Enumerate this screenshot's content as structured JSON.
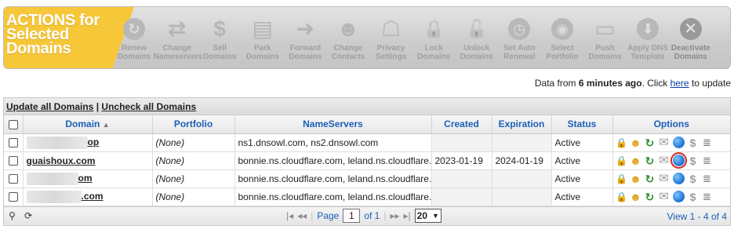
{
  "toolbar": {
    "title": "ACTIONS for Selected Domains",
    "actions": [
      {
        "label": "Renew\nDomains",
        "icon": "renew-icon"
      },
      {
        "label": "Change\nNameservers",
        "icon": "swap-arrows-icon"
      },
      {
        "label": "Sell\nDomains",
        "icon": "dollar-icon"
      },
      {
        "label": "Park\nDomains",
        "icon": "park-icon"
      },
      {
        "label": "Forward\nDomains",
        "icon": "arrow-right-icon"
      },
      {
        "label": "Change\nContacts",
        "icon": "contacts-icon"
      },
      {
        "label": "Privacy\nSettings",
        "icon": "privacy-icon"
      },
      {
        "label": "Lock\nDomains",
        "icon": "lock-icon"
      },
      {
        "label": "Unlock\nDomains",
        "icon": "unlock-icon"
      },
      {
        "label": "Set Auto\nRenewal",
        "icon": "clock-icon"
      },
      {
        "label": "Select\nPortfolio",
        "icon": "portfolio-icon"
      },
      {
        "label": "Push\nDomains",
        "icon": "push-icon"
      },
      {
        "label": "Apply DNS\nTemplate",
        "icon": "dns-template-icon"
      },
      {
        "label": "Deactivate\nDomains",
        "icon": "deactivate-icon"
      }
    ]
  },
  "freshness": {
    "prefix": "Data from ",
    "age": "6 minutes ago",
    "middle": ". Click ",
    "link": "here",
    "suffix": " to update"
  },
  "grid_actions": {
    "update_all": "Update all Domains",
    "separator": "|",
    "uncheck_all": "Uncheck all Domains"
  },
  "columns": {
    "domain": "Domain",
    "portfolio": "Portfolio",
    "nameservers": "NameServers",
    "created": "Created",
    "expiration": "Expiration",
    "status": "Status",
    "options": "Options"
  },
  "rows": [
    {
      "domain": "op",
      "portfolio": "(None)",
      "nameservers": "ns1.dnsowl.com, ns2.dnsowl.com",
      "created": "",
      "expiration": "",
      "status": "Active"
    },
    {
      "domain": "guaishoux.com",
      "portfolio": "(None)",
      "nameservers": "bonnie.ns.cloudflare.com, leland.ns.cloudflare.com",
      "created": "2023-01-19",
      "expiration": "2024-01-19",
      "status": "Active"
    },
    {
      "domain": "om",
      "portfolio": "(None)",
      "nameservers": "bonnie.ns.cloudflare.com, leland.ns.cloudflare.com",
      "created": "",
      "expiration": "",
      "status": "Active"
    },
    {
      "domain": ".com",
      "portfolio": "(None)",
      "nameservers": "bonnie.ns.cloudflare.com, leland.ns.cloudflare.com",
      "created": "",
      "expiration": "",
      "status": "Active"
    }
  ],
  "pager": {
    "page_label": "Page",
    "page_value": "1",
    "of_label": "of 1",
    "page_size": "20",
    "view_info": "View 1 - 4 of 4"
  },
  "colors": {
    "toolbar_title_bg": "#f7c73a",
    "header_text": "#1c5fb8",
    "highlight": "#d9261c"
  }
}
